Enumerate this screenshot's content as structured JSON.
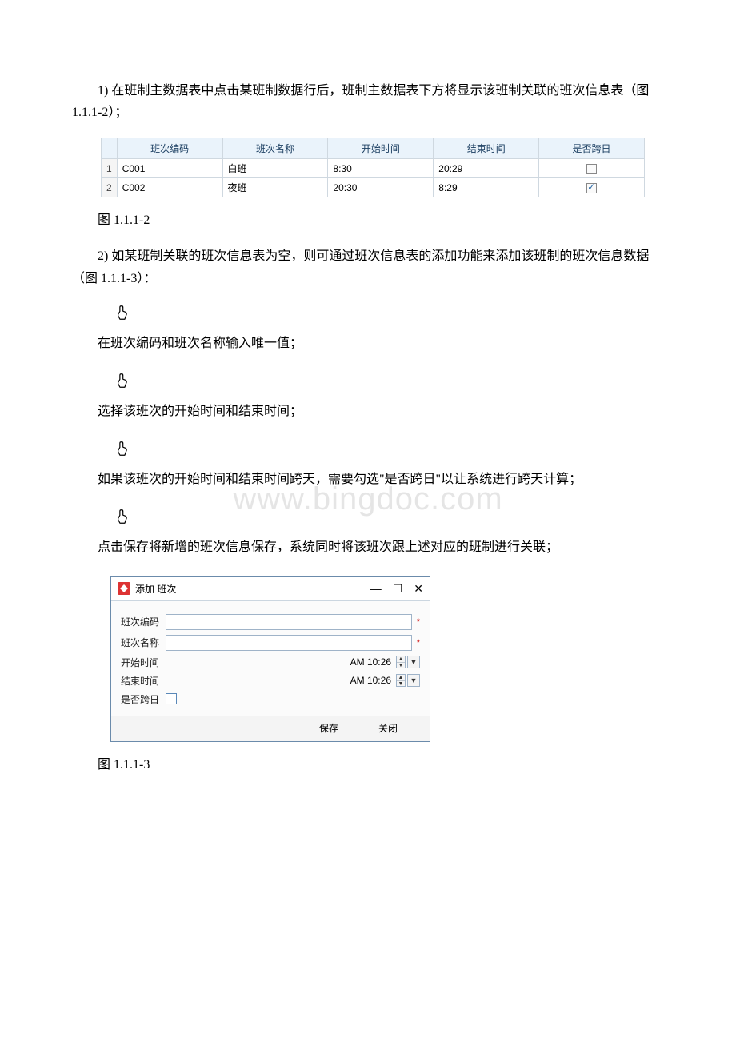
{
  "paragraphs": {
    "p1": "1) 在班制主数据表中点击某班制数据行后，班制主数据表下方将显示该班制关联的班次信息表（图 1.1.1-2）；",
    "caption1": "图 1.1.1-2",
    "p2": "2) 如某班制关联的班次信息表为空，则可通过班次信息表的添加功能来添加该班制的班次信息数据（图 1.1.1-3）：",
    "li1": "在班次编码和班次名称输入唯一值；",
    "li2": "选择该班次的开始时间和结束时间；",
    "li3": "如果该班次的开始时间和结束时间跨天，需要勾选\"是否跨日\"以让系统进行跨天计算；",
    "li4": "点击保存将新增的班次信息保存，系统同时将该班次跟上述对应的班制进行关联；",
    "caption2": "图 1.1.1-3"
  },
  "table": {
    "headers": [
      "班次编码",
      "班次名称",
      "开始时间",
      "结束时间",
      "是否跨日"
    ],
    "rows": [
      {
        "idx": "1",
        "code": "C001",
        "name": "白班",
        "start": "8:30",
        "end": "20:29",
        "cross": false
      },
      {
        "idx": "2",
        "code": "C002",
        "name": "夜班",
        "start": "20:30",
        "end": "8:29",
        "cross": true
      }
    ]
  },
  "dialog": {
    "title": "添加 班次",
    "win": {
      "min": "—",
      "max": "☐",
      "close": "✕"
    },
    "fields": {
      "code": {
        "label": "班次编码",
        "value": "",
        "required": "*"
      },
      "name": {
        "label": "班次名称",
        "value": "",
        "required": "*"
      },
      "start": {
        "label": "开始时间",
        "value": "AM 10:26"
      },
      "end": {
        "label": "结束时间",
        "value": "AM 10:26"
      },
      "cross": {
        "label": "是否跨日"
      }
    },
    "buttons": {
      "save": "保存",
      "close": "关闭"
    }
  },
  "watermark": "www.bingdoc.com"
}
